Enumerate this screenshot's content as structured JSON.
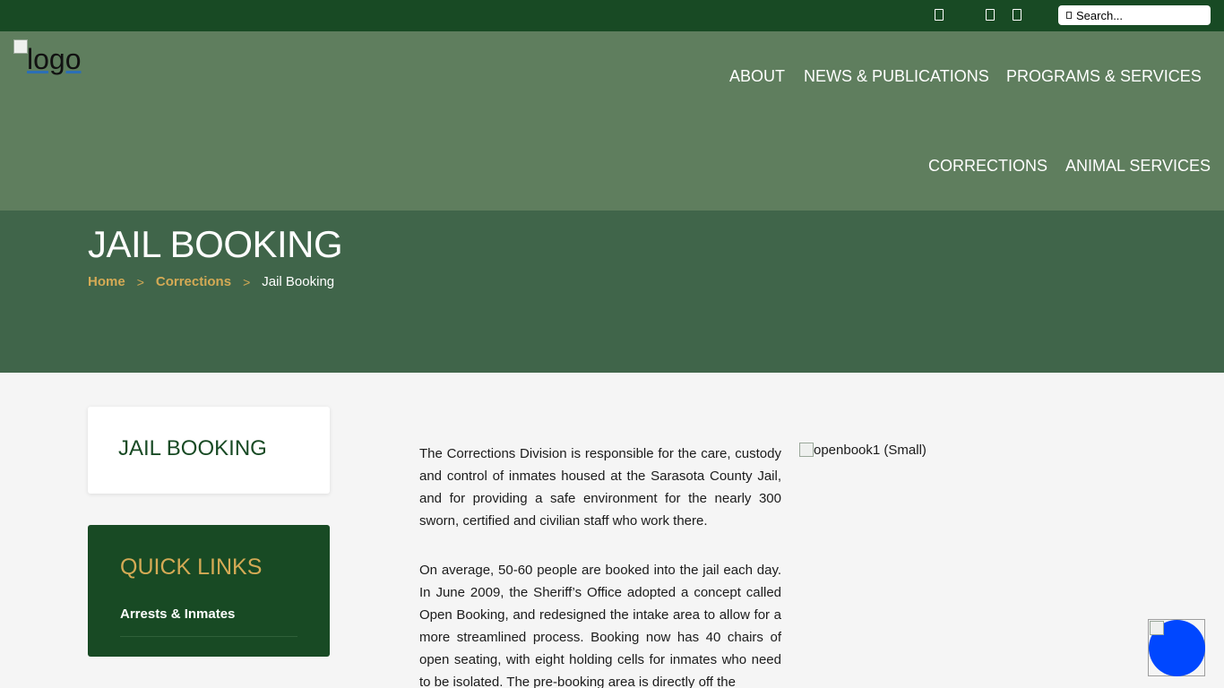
{
  "topbar": {
    "icons": [
      "social-icon-1",
      "social-icon-2",
      "social-icon-3"
    ],
    "search_placeholder": "Search..."
  },
  "header": {
    "logo_alt": "logo",
    "nav": [
      "ABOUT",
      "NEWS & PUBLICATIONS",
      "PROGRAMS & SERVICES",
      "CORRECTIONS",
      "ANIMAL SERVICES"
    ]
  },
  "hero": {
    "title": "JAIL BOOKING",
    "breadcrumb": {
      "home": "Home",
      "section": "Corrections",
      "current": "Jail Booking",
      "separator": ">"
    }
  },
  "sidebar": {
    "title": "JAIL BOOKING",
    "quick_links_title": "QUICK LINKS",
    "links": [
      "Arrests & Inmates"
    ]
  },
  "content": {
    "paragraphs": [
      "The Corrections Division is responsible for the care, custody and control of inmates housed at the Sarasota County Jail, and for providing a safe environment for the nearly 300 sworn, certified and civilian staff who work there.",
      "On average, 50-60 people are booked into the jail each day. In June 2009, the Sheriff’s Office adopted a concept called Open Booking, and redesigned the intake area to allow for a more streamlined process. Booking now has 40 chairs of open seating, with eight holding cells for inmates who need to be isolated. The pre-booking area is directly off the"
    ],
    "image_alt": "openbook1 (Small)"
  },
  "colors": {
    "topbar": "#184a24",
    "header": "#5f7e5e",
    "hero": "#40654a",
    "accent_gold": "#d4aa55",
    "chat_blue": "#0047ff"
  }
}
